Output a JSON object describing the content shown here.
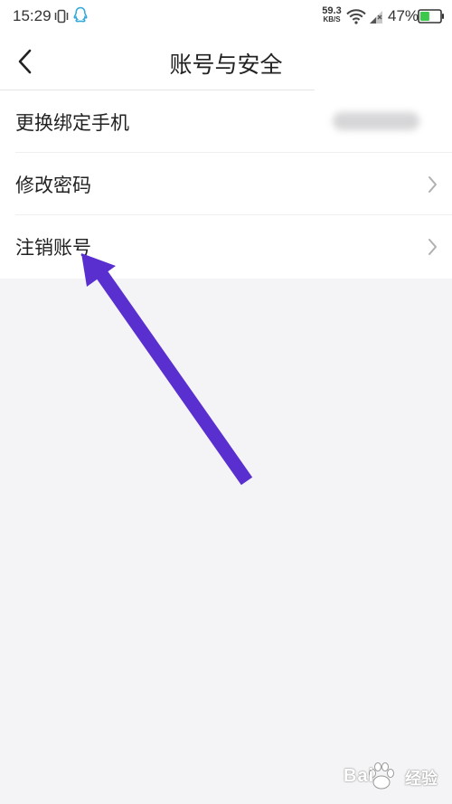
{
  "status_bar": {
    "time": "15:29",
    "net_speed_value": "59.3",
    "net_speed_unit": "KB/S",
    "battery_percent": "47%",
    "icons": [
      "vibrate-icon",
      "qq-icon",
      "wifi-icon",
      "signal-icon",
      "battery-icon"
    ],
    "battery_level": 0.47,
    "battery_color": "#3cc84a"
  },
  "navbar": {
    "title": "账号与安全",
    "back_icon": "chevron-left-icon"
  },
  "menu": {
    "items": [
      {
        "label": "更换绑定手机",
        "value_blurred": true
      },
      {
        "label": "修改密码",
        "chevron": "chevron-right-icon"
      },
      {
        "label": "注销账号",
        "chevron": "chevron-right-icon"
      }
    ]
  },
  "annotation": {
    "arrow_color": "#5a2fd0"
  },
  "watermark": {
    "text": "Bai",
    "text_cn": "经验",
    "icon": "baidu-paw-icon"
  }
}
